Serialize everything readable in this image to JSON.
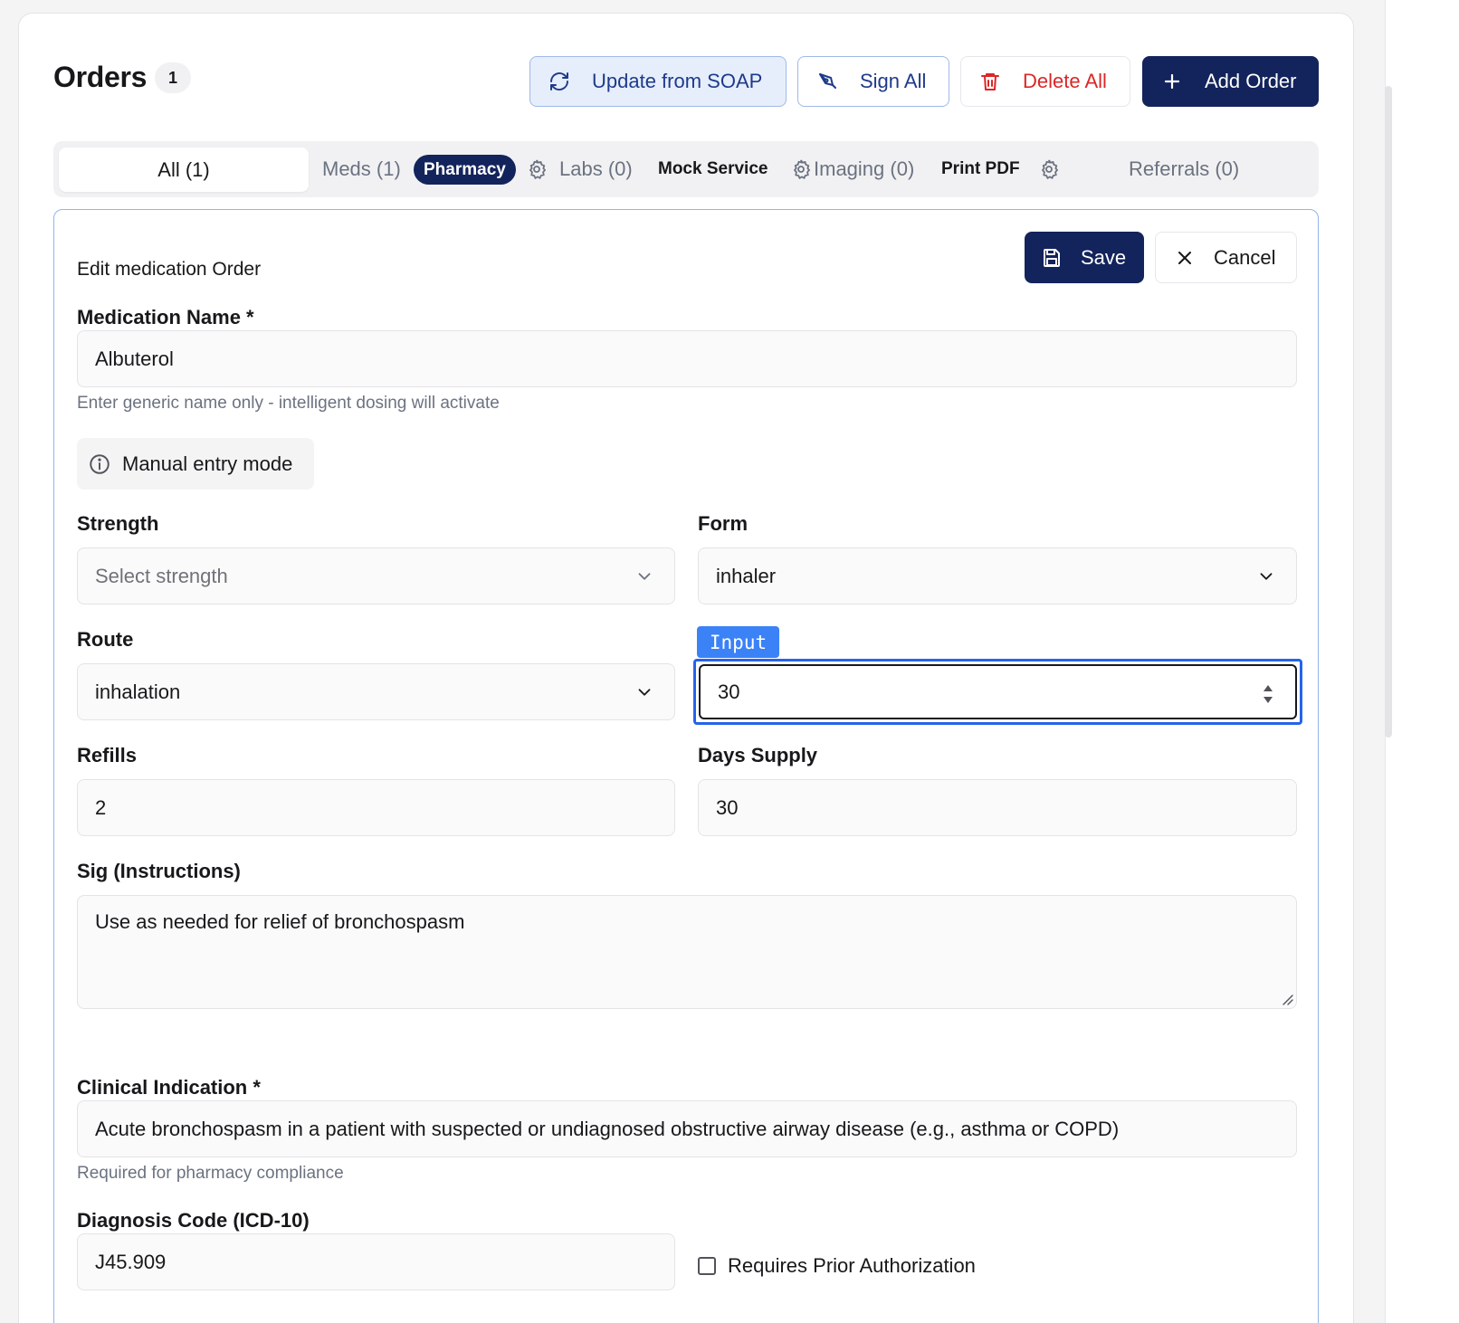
{
  "header": {
    "title": "Orders",
    "count": "1",
    "buttons": {
      "update_soap": "Update from SOAP",
      "sign_all": "Sign All",
      "delete_all": "Delete All",
      "add_order": "Add Order"
    }
  },
  "tabs": {
    "all": "All (1)",
    "meds": "Meds (1)",
    "pharmacy": "Pharmacy",
    "labs": "Labs (0)",
    "mock_service": "Mock Service",
    "imaging": "Imaging (0)",
    "print_pdf": "Print PDF",
    "referrals": "Referrals (0)"
  },
  "edit": {
    "title": "Edit medication Order",
    "save": "Save",
    "cancel": "Cancel",
    "medication_name_label": "Medication Name *",
    "medication_name_value": "Albuterol",
    "medication_hint": "Enter generic name only - intelligent dosing will activate",
    "manual_mode": "Manual entry mode",
    "strength_label": "Strength",
    "strength_placeholder": "Select strength",
    "form_label": "Form",
    "form_value": "inhaler",
    "route_label": "Route",
    "route_value": "inhalation",
    "input_tag": "Input",
    "quantity_value": "30",
    "refills_label": "Refills",
    "refills_value": "2",
    "days_supply_label": "Days Supply",
    "days_supply_value": "30",
    "sig_label": "Sig (Instructions)",
    "sig_value": "Use as needed for relief of bronchospasm",
    "clinical_indication_label": "Clinical Indication *",
    "clinical_indication_value": "Acute bronchospasm in a patient with suspected or undiagnosed obstructive airway disease (e.g., asthma or COPD)",
    "clinical_hint": "Required for pharmacy compliance",
    "diagnosis_label": "Diagnosis Code (ICD-10)",
    "diagnosis_value": "J45.909",
    "prior_auth_label": "Requires Prior Authorization"
  },
  "colors": {
    "primary": "#13235c",
    "danger": "#dc2626",
    "focus": "#2563eb"
  }
}
